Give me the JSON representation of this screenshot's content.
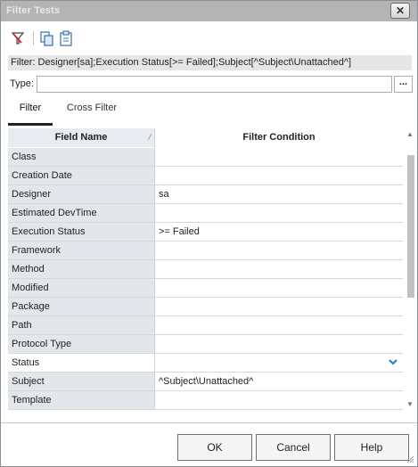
{
  "window": {
    "title": "Filter Tests",
    "close_label": "✕"
  },
  "toolbar": {
    "buttons": [
      {
        "name": "clear-filter",
        "icon": "filter-clear-icon"
      },
      {
        "name": "copy-filter",
        "icon": "copy-icon"
      },
      {
        "name": "paste-filter",
        "icon": "paste-icon"
      }
    ]
  },
  "filter_text": "Filter: Designer[sa];Execution Status[>= Failed];Subject[^Subject\\Unattached^]",
  "type_field": {
    "label": "Type:",
    "value": "",
    "browse_label": "..."
  },
  "tabs": [
    {
      "label": "Filter",
      "active": true
    },
    {
      "label": "Cross Filter",
      "active": false
    }
  ],
  "grid": {
    "headers": {
      "field_name": "Field Name",
      "filter_condition": "Filter Condition"
    },
    "rows": [
      {
        "field": "Class",
        "condition": ""
      },
      {
        "field": "Creation Date",
        "condition": ""
      },
      {
        "field": "Designer",
        "condition": "sa"
      },
      {
        "field": "Estimated DevTime",
        "condition": ""
      },
      {
        "field": "Execution Status",
        "condition": ">= Failed"
      },
      {
        "field": "Framework",
        "condition": ""
      },
      {
        "field": "Method",
        "condition": ""
      },
      {
        "field": "Modified",
        "condition": ""
      },
      {
        "field": "Package",
        "condition": ""
      },
      {
        "field": "Path",
        "condition": ""
      },
      {
        "field": "Protocol Type",
        "condition": ""
      },
      {
        "field": "Status",
        "condition": "",
        "selected": true
      },
      {
        "field": "Subject",
        "condition": "^Subject\\Unattached^"
      },
      {
        "field": "Template",
        "condition": ""
      }
    ]
  },
  "buttons": {
    "ok": "OK",
    "cancel": "Cancel",
    "help": "Help"
  },
  "colors": {
    "accent": "#1a7fc1",
    "header_bg": "#e3e7ec",
    "title_bar": "#b4b4b4"
  }
}
